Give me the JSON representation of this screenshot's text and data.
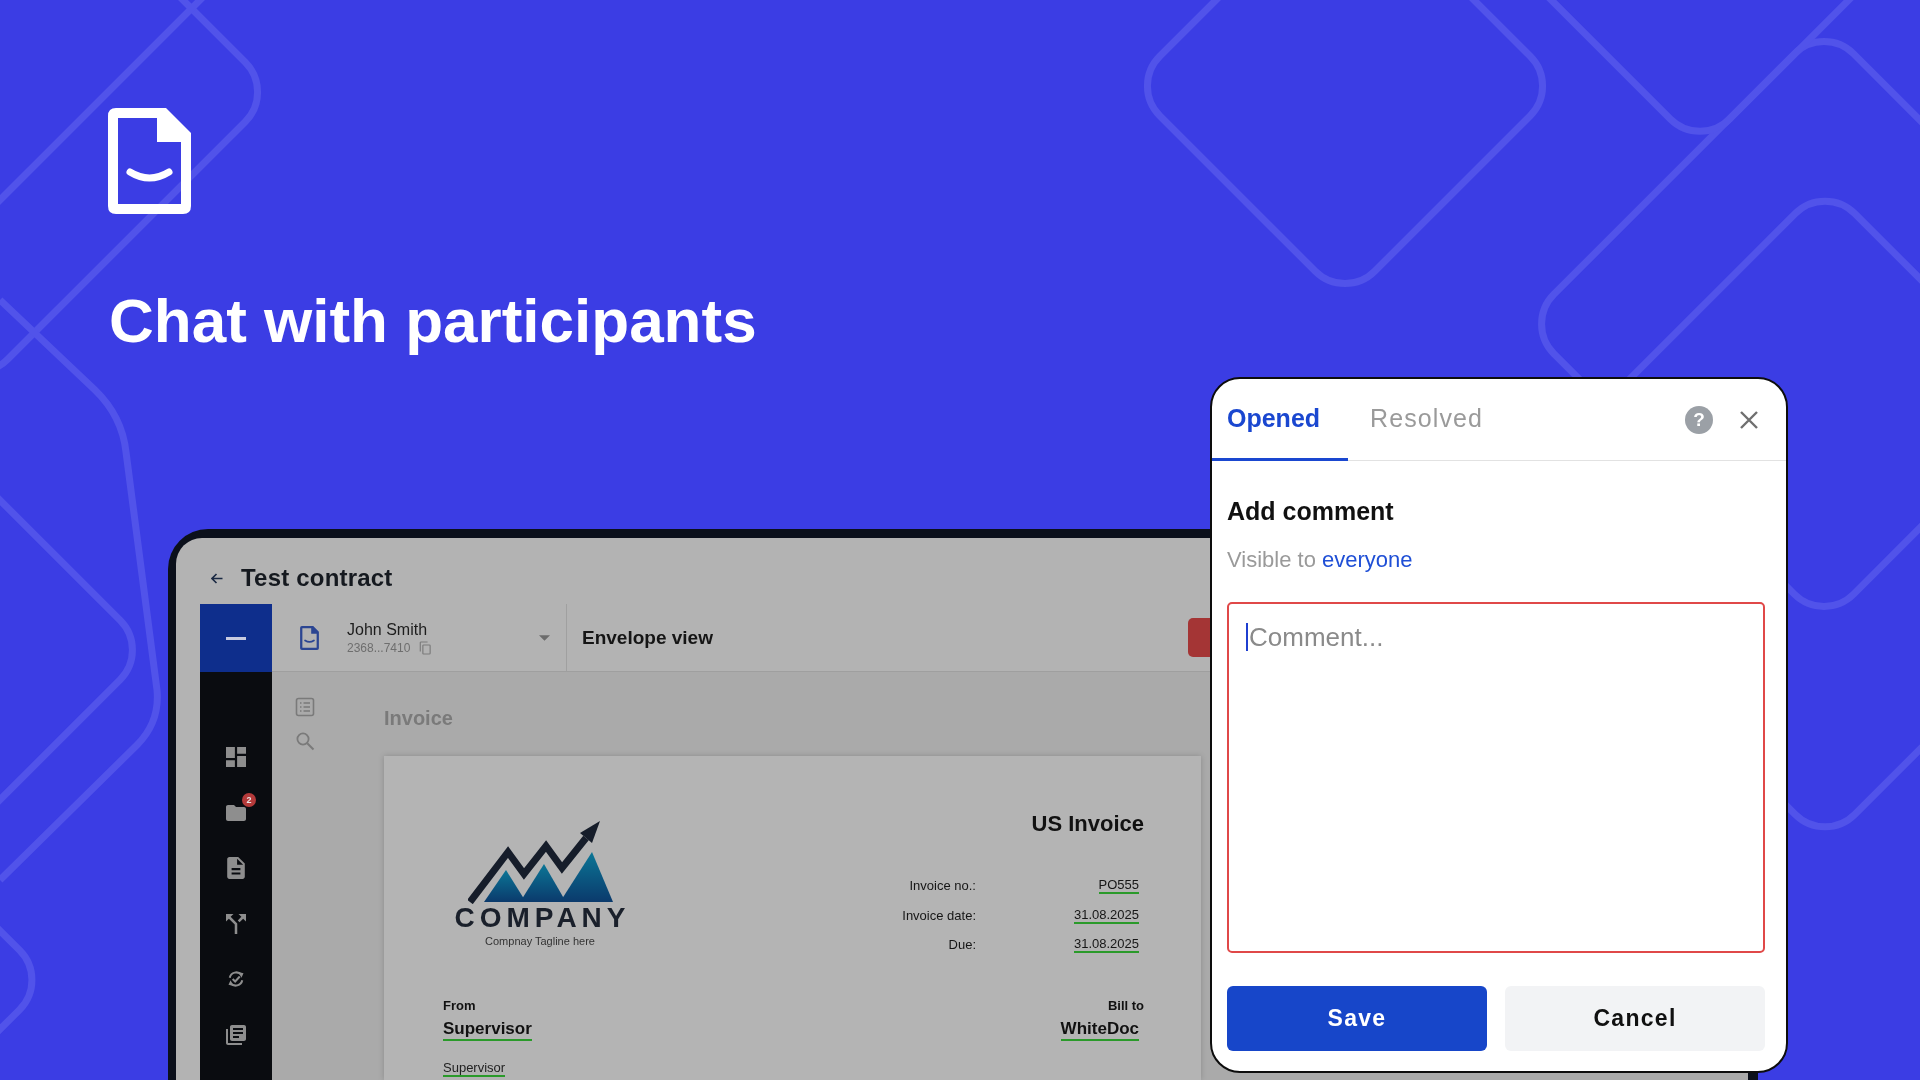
{
  "hero": {
    "title": "Chat with participants"
  },
  "app": {
    "header": {
      "title": "Test contract"
    },
    "sidebar": {
      "notification_count": "2"
    },
    "signer": {
      "name": "John Smith",
      "id": "2368...7410"
    },
    "view_title": "Envelope view",
    "document": {
      "heading": "Invoice",
      "company": {
        "name": "COMPANY",
        "tagline": "Compnay Tagline here"
      },
      "title": "US Invoice",
      "details": [
        {
          "label": "Invoice no.:",
          "value": "PO555"
        },
        {
          "label": "Invoice date:",
          "value": "31.08.2025"
        },
        {
          "label": "Due:",
          "value": "31.08.2025"
        }
      ],
      "from": {
        "label": "From",
        "name": "Supervisor",
        "contact": "Supervisor"
      },
      "bill_to": {
        "label": "Bill to",
        "name": "WhiteDoc"
      }
    }
  },
  "comments_panel": {
    "tabs": [
      {
        "label": "Opened",
        "selected": true
      },
      {
        "label": "Resolved",
        "selected": false
      }
    ],
    "help": "?",
    "heading": "Add comment",
    "visibility": {
      "prefix": "Visible to",
      "audience": "everyone"
    },
    "comment_field": {
      "placeholder": "Comment...",
      "focused": true
    },
    "buttons": [
      {
        "label": "Save",
        "kind": "primary"
      },
      {
        "label": "Cancel",
        "kind": "secondary"
      }
    ]
  }
}
